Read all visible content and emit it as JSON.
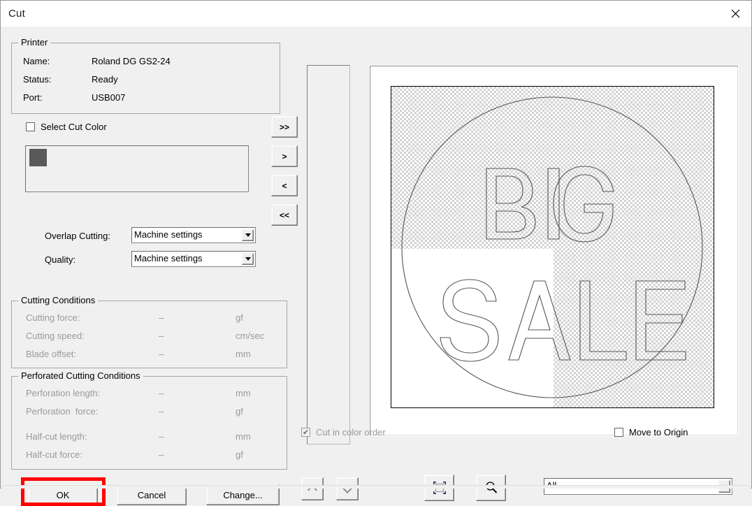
{
  "window": {
    "title": "Cut",
    "close_icon": "close-icon"
  },
  "printer": {
    "legend": "Printer",
    "rows": [
      {
        "label": "Name:",
        "value": "Roland DG GS2-24"
      },
      {
        "label": "Status:",
        "value": "Ready"
      },
      {
        "label": "Port:",
        "value": "USB007"
      }
    ]
  },
  "cut_color": {
    "checkbox_label": "Select Cut Color",
    "checked": false,
    "swatch_color": "#595959"
  },
  "transfer_buttons": [
    {
      "label": ">>",
      "name": "move-all-right-button"
    },
    {
      "label": ">",
      "name": "move-right-button"
    },
    {
      "label": "<",
      "name": "move-left-button"
    },
    {
      "label": "<<",
      "name": "move-all-left-button"
    }
  ],
  "settings": {
    "overlap_label": "Overlap Cutting:",
    "overlap_value": "Machine settings",
    "quality_label": "Quality:",
    "quality_value": "Machine settings"
  },
  "cutting_conditions": {
    "legend": "Cutting Conditions",
    "rows": [
      {
        "label": "Cutting force:",
        "value": "–",
        "unit": "gf"
      },
      {
        "label": "Cutting speed:",
        "value": "–",
        "unit": "cm/sec"
      },
      {
        "label": "Blade offset:",
        "value": "–",
        "unit": "mm"
      }
    ]
  },
  "perforated_conditions": {
    "legend": "Perforated Cutting Conditions",
    "rows": [
      {
        "label": "Perforation length:",
        "value": "–",
        "unit": "mm"
      },
      {
        "label": "Perforation  force:",
        "value": "–",
        "unit": "gf"
      },
      {
        "label": "Half-cut length:",
        "value": "–",
        "unit": "mm"
      },
      {
        "label": "Half-cut force:",
        "value": "–",
        "unit": "gf"
      }
    ]
  },
  "preview": {
    "artwork_text_line1": "BIG",
    "artwork_text_line2": "SALE",
    "background": "transparency-checkerboard"
  },
  "options": {
    "cut_in_color_order_label": "Cut in color order",
    "cut_in_color_order_checked": true,
    "cut_in_color_order_disabled": true,
    "move_to_origin_label": "Move to Origin",
    "move_to_origin_checked": false
  },
  "bottom_buttons": {
    "ok": "OK",
    "cancel": "Cancel",
    "change": "Change...",
    "move_up_icon": "chevron-up-icon",
    "move_down_icon": "chevron-down-icon",
    "fit_selection_icon": "selection-bounds-icon",
    "zoom_icon": "magnifier-icon"
  },
  "range_combo": {
    "value": "All",
    "options": [
      "All"
    ]
  },
  "annotation": {
    "highlight_color": "#ff0000",
    "highlight_target": "OK"
  }
}
